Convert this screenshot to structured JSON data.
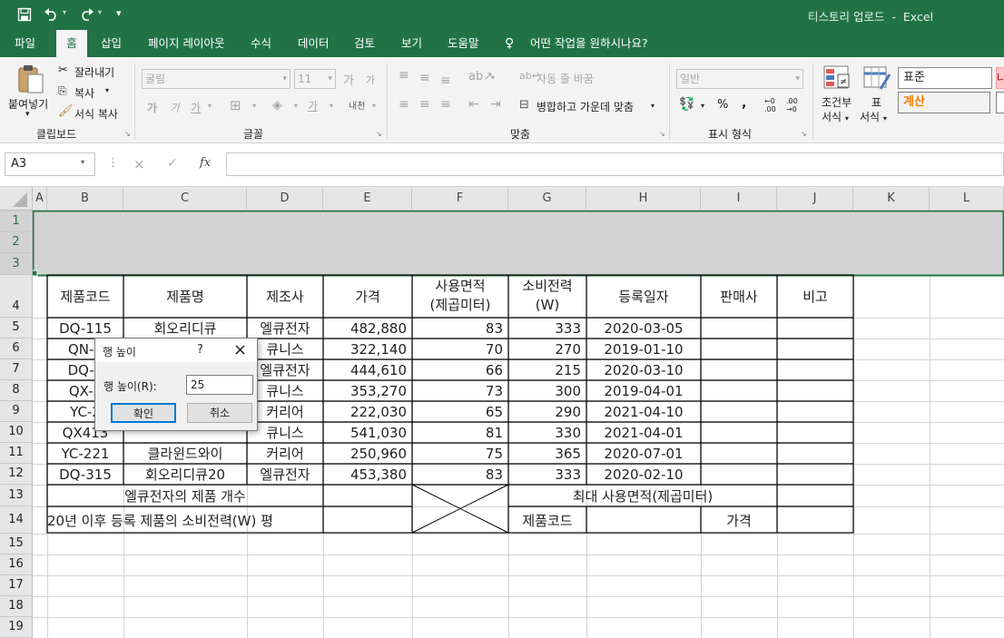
{
  "title_bar": {
    "title": "티스토리 업로드",
    "separator": "-",
    "app": "Excel",
    "qat": {
      "save_icon": "save-icon",
      "undo_icon": "undo-icon",
      "redo_icon": "redo-icon",
      "customize": "▾"
    }
  },
  "tabs": [
    "파일",
    "홈",
    "삽입",
    "페이지 레이아웃",
    "수식",
    "데이터",
    "검토",
    "보기",
    "도움말"
  ],
  "active_tab": "홈",
  "tell_me": "어떤 작업을 원하시나요?",
  "clipboard": {
    "paste": "붙여넣기",
    "cut": "잘라내기",
    "copy": "복사",
    "format_painter": "서식 복사",
    "group": "클립보드"
  },
  "font": {
    "name": "굴림",
    "size": "11",
    "increase": "가",
    "decrease": "가",
    "bold": "가",
    "italic": "가",
    "underline": "가",
    "fill": "가",
    "phonetic": "내천",
    "group": "글꼴"
  },
  "alignment": {
    "wrap_text": "자동 줄 바꿈",
    "merge_center": "병합하고 가운데 맞춤",
    "group": "맞춤"
  },
  "number": {
    "format": "일반",
    "percent": "%",
    "comma": ",",
    "inc_decimal": "←0 .00",
    "dec_decimal": ".00 →0",
    "group": "표시 형식"
  },
  "styles": {
    "conditional_1": "조건부",
    "conditional_2": "서식",
    "table_1": "표",
    "table_2": "서식",
    "normal": "표준",
    "calc": "계산",
    "partial": "나"
  },
  "formula_bar": {
    "name_box": "A3",
    "cancel": "×",
    "enter": "✓",
    "fx": "fx",
    "value": ""
  },
  "columns": [
    "A",
    "B",
    "C",
    "D",
    "E",
    "F",
    "G",
    "H",
    "I",
    "J",
    "K",
    "L"
  ],
  "rows": [
    "1",
    "2",
    "3",
    "4",
    "5",
    "6",
    "7",
    "8",
    "9",
    "10",
    "11",
    "12",
    "13",
    "14",
    "15",
    "16",
    "17",
    "18",
    "19"
  ],
  "table": {
    "headers": {
      "code": "제품코드",
      "name": "제품명",
      "maker": "제조사",
      "price": "가격",
      "area_1": "사용면적",
      "area_2": "(제곱미터)",
      "power_1": "소비전력",
      "power_2": "(W)",
      "date": "등록일자",
      "seller": "판매사",
      "note": "비고"
    },
    "rows": [
      {
        "code": "DQ-115",
        "name": "회오리디큐",
        "maker": "엘큐전자",
        "price": "482,880",
        "area": "83",
        "power": "333",
        "date": "2020-03-05"
      },
      {
        "code": "QN-3",
        "name": "",
        "maker": "큐니스",
        "price": "322,140",
        "area": "70",
        "power": "270",
        "date": "2019-01-10"
      },
      {
        "code": "DQ-1",
        "name": "",
        "maker": "엘큐전자",
        "price": "444,610",
        "area": "66",
        "power": "215",
        "date": "2020-03-10"
      },
      {
        "code": "QX-2",
        "name": "",
        "maker": "큐니스",
        "price": "353,270",
        "area": "73",
        "power": "300",
        "date": "2019-04-01"
      },
      {
        "code": "YC-2",
        "name": "",
        "maker": "커리어",
        "price": "222,030",
        "area": "65",
        "power": "290",
        "date": "2021-04-10"
      },
      {
        "code": "QX413",
        "name": "",
        "maker": "큐니스",
        "price": "541,030",
        "area": "81",
        "power": "330",
        "date": "2021-04-01"
      },
      {
        "code": "YC-221",
        "name": "클라윈드와이",
        "maker": "커리어",
        "price": "250,960",
        "area": "75",
        "power": "365",
        "date": "2020-07-01"
      },
      {
        "code": "DQ-315",
        "name": "회오리디큐20",
        "maker": "엘큐전자",
        "price": "453,380",
        "area": "83",
        "power": "333",
        "date": "2020-02-10"
      }
    ],
    "summary_1": "엘큐전자의 제품 개수",
    "summary_2": "20년 이후 등록 제품의 소비전력(W) 평",
    "max_area": "최대 사용면적(제곱미터)",
    "code_label": "제품코드",
    "price_label": "가격"
  },
  "dialog": {
    "title": "행 높이",
    "help": "?",
    "close": "×",
    "label": "행 높이(R):",
    "value": "25",
    "ok": "확인",
    "cancel": "취소"
  }
}
